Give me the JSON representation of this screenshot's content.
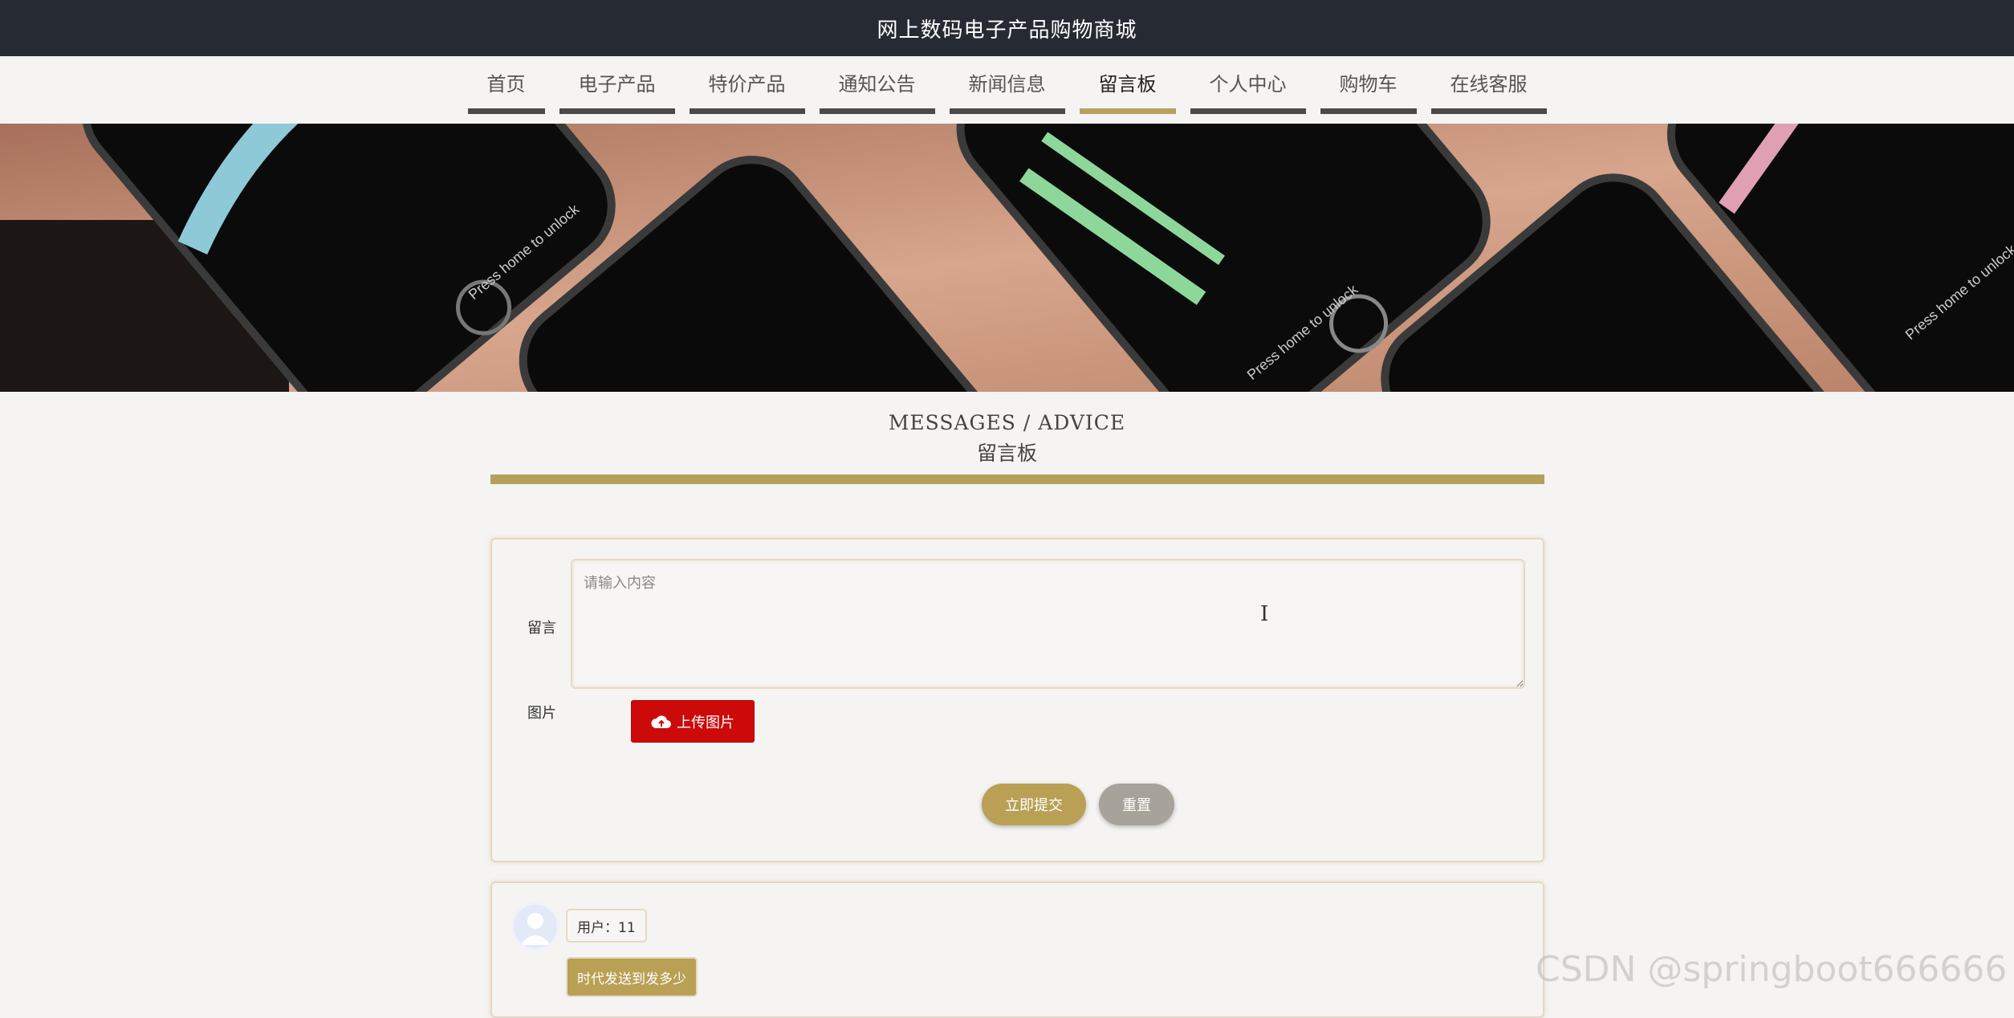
{
  "header": {
    "title": "网上数码电子产品购物商城"
  },
  "nav": {
    "items": [
      {
        "label": "首页",
        "active": false
      },
      {
        "label": "电子产品",
        "active": false
      },
      {
        "label": "特价产品",
        "active": false
      },
      {
        "label": "通知公告",
        "active": false
      },
      {
        "label": "新闻信息",
        "active": false
      },
      {
        "label": "留言板",
        "active": true
      },
      {
        "label": "个人中心",
        "active": false
      },
      {
        "label": "购物车",
        "active": false
      },
      {
        "label": "在线客服",
        "active": false
      }
    ]
  },
  "banner": {
    "lock_text": "Press home to unlock"
  },
  "section": {
    "title_en": "MESSAGES / ADVICE",
    "title_cn": "留言板"
  },
  "form": {
    "message_label": "留言",
    "message_placeholder": "请输入内容",
    "message_value": "",
    "image_label": "图片",
    "upload_label": "上传图片",
    "submit_label": "立即提交",
    "reset_label": "重置"
  },
  "messages": [
    {
      "user": "用户：11",
      "content": "时代发送到发多少"
    }
  ],
  "watermark": "CSDN @springboot666666",
  "colors": {
    "topbar": "#262a33",
    "accent": "#b9a055",
    "upload": "#cc0a0a",
    "reset": "#a8a39a"
  }
}
